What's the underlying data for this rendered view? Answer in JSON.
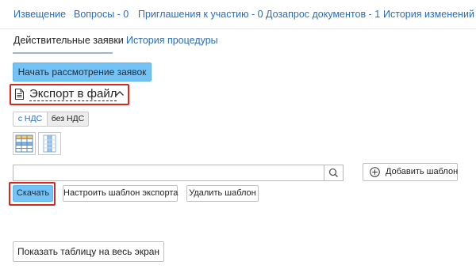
{
  "topnav": {
    "items": [
      {
        "label": "Извещение"
      },
      {
        "label": "Вопросы - 0"
      },
      {
        "label": "Приглашения к участию - 0"
      },
      {
        "label": "Дозапрос документов - 1"
      },
      {
        "label": "История изменений"
      }
    ]
  },
  "subtabs": {
    "items": [
      {
        "label": "Действительные заявки",
        "active": true
      },
      {
        "label": "История процедуры",
        "active": false
      }
    ]
  },
  "actions": {
    "start_review": "Начать рассмотрение заявок"
  },
  "export": {
    "title": "Экспорт в файл",
    "icon": "document-icon",
    "toggle_icon": "chevron-up-icon",
    "vat_options": [
      {
        "label": "с НДС",
        "selected": true
      },
      {
        "label": "без НДС",
        "selected": false
      }
    ],
    "view_icons": [
      "table-grid-view-icon",
      "column-view-icon"
    ],
    "search": {
      "value": "",
      "placeholder": ""
    },
    "add_template": "Добавить шаблон",
    "download": "Скачать",
    "configure_template": "Настроить шаблон экспорта",
    "delete_template": "Удалить шаблон"
  },
  "footer": {
    "fullscreen": "Показать таблицу на весь экран"
  },
  "colors": {
    "link": "#2a6ebb",
    "primary_button": "#74c3f6",
    "highlight_outline": "#e2231a"
  }
}
